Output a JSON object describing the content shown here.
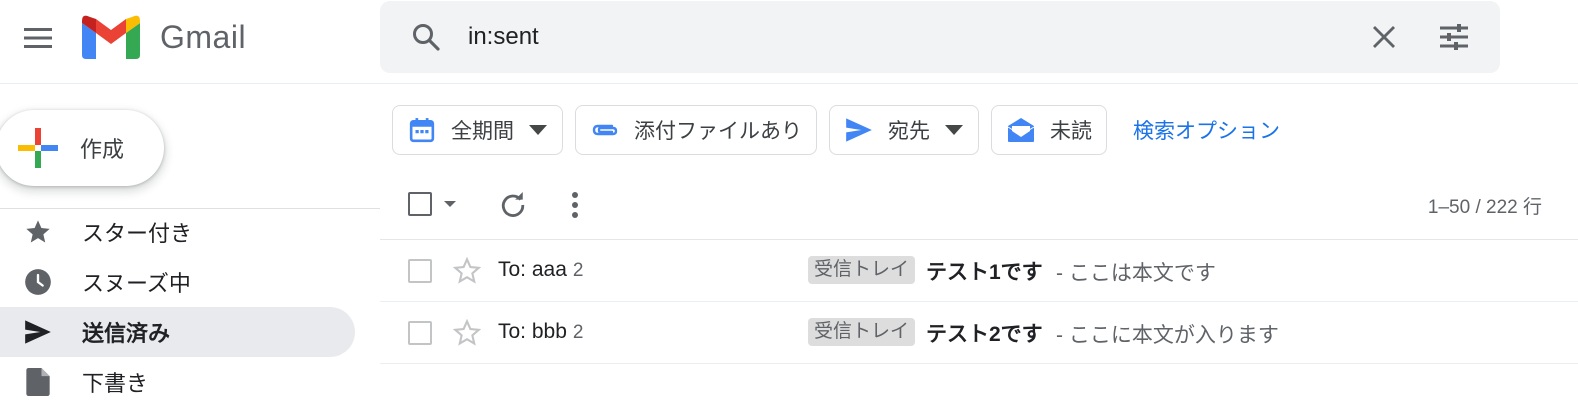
{
  "header": {
    "app_name": "Gmail",
    "search_value": "in:sent",
    "colors": {
      "search_bg": "#f1f3f4",
      "accent": "#1a73e8"
    }
  },
  "sidebar": {
    "compose_label": "作成",
    "items": [
      {
        "label": "スター付き",
        "icon": "star-icon"
      },
      {
        "label": "スヌーズ中",
        "icon": "clock-icon"
      },
      {
        "label": "送信済み",
        "icon": "send-icon",
        "active": true
      },
      {
        "label": "下書き",
        "icon": "draft-icon"
      }
    ]
  },
  "filters": {
    "chips": [
      {
        "label": "全期間",
        "icon": "calendar-icon",
        "dropdown": true
      },
      {
        "label": "添付ファイルあり",
        "icon": "attachment-icon",
        "dropdown": false
      },
      {
        "label": "宛先",
        "icon": "send-icon",
        "dropdown": true
      },
      {
        "label": "未読",
        "icon": "mail-unread-icon",
        "dropdown": false
      }
    ],
    "advanced_link": "検索オプション"
  },
  "toolbar": {
    "count": "1–50 / 222 行"
  },
  "messages": [
    {
      "from": "To: aaa",
      "count": "2",
      "label": "受信トレイ",
      "subject": "テスト1です",
      "snippet": "- ここは本文です"
    },
    {
      "from": "To: bbb",
      "count": "2",
      "label": "受信トレイ",
      "subject": "テスト2です",
      "snippet": "- ここに本文が入ります"
    }
  ]
}
